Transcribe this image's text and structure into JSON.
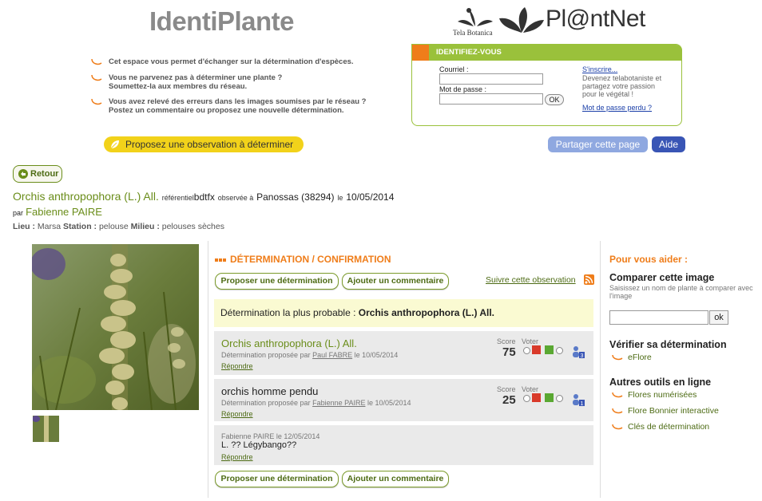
{
  "header": {
    "site_title": "IdentiPlante",
    "partner_tb": "Tela Botanica",
    "partner_pn": "Pl@ntNet"
  },
  "intro": [
    "Cet espace vous permet d'échanger sur la détermination d'espèces.",
    "Vous ne parvenez pas à déterminer une plante ?",
    "Soumettez-la aux membres du réseau.",
    "Vous avez relevé des erreurs dans les images soumises par le réseau ?",
    "Postez un commentaire ou proposez une nouvelle détermination."
  ],
  "login": {
    "title": "IDENTIFIEZ-VOUS",
    "email_label": "Courriel :",
    "password_label": "Mot de passe :",
    "ok_label": "OK",
    "signup_link": "S'inscrire...",
    "signup_info": [
      "Devenez telabotaniste et",
      "partagez votre passion",
      "pour le végétal !"
    ],
    "lost_password": "Mot de passe perdu ?"
  },
  "actions": {
    "propose_observation": "Proposez une observation à déterminer",
    "share": "Partager cette page",
    "help": "Aide",
    "back": "Retour"
  },
  "observation": {
    "species": "Orchis anthropophora (L.) All.",
    "ref_label": "référentiel",
    "ref_value": "bdtfx",
    "observed_label": "observée à",
    "place": "Panossas (38294)",
    "date_label": "le",
    "date": "10/05/2014",
    "by_label": "par",
    "author": "Fabienne PAIRE",
    "lieu_label": "Lieu :",
    "lieu_value": "Marsa",
    "station_label": "Station :",
    "station_value": "pelouse",
    "milieu_label": "Milieu :",
    "milieu_value": "pelouses sèches"
  },
  "determination": {
    "section_title": "DÉTERMINATION / CONFIRMATION",
    "propose_btn": "Proposer une détermination",
    "comment_btn": "Ajouter un commentaire",
    "follow_link": "Suivre cette observation",
    "probable_label": "Détermination la plus probable :",
    "probable_value": "Orchis anthropophora (L.) All.",
    "score_label": "Score",
    "vote_label": "Voter",
    "reply_label": "Répondre",
    "proposals": [
      {
        "name": "Orchis anthropophora (L.) All.",
        "meta_prefix": "Détermination proposée par",
        "author": "Paul FABRE",
        "date_prefix": "le",
        "date": "10/05/2014",
        "score": "75",
        "votes": "3"
      },
      {
        "name": "orchis homme pendu",
        "meta_prefix": "Détermination proposée par",
        "author": "Fabienne PAIRE",
        "date_prefix": "le",
        "date": "10/05/2014",
        "score": "25",
        "votes": "1"
      }
    ],
    "comment": {
      "header": "Fabienne PAIRE le 12/05/2014",
      "text": "L. ?? Légybangо??"
    }
  },
  "help": {
    "title": "Pour vous aider :",
    "compare_title": "Comparer cette image",
    "compare_desc": "Saisissez un nom de plante à comparer avec l'image",
    "ok_label": "ok",
    "verify_title": "Vérifier sa détermination",
    "verify_link": "eFlore",
    "tools_title": "Autres outils en ligne",
    "tools": [
      "Flores numérisées",
      "Flore Bonnier interactive",
      "Clés de détermination"
    ]
  },
  "colors": {
    "accent_green": "#9ac13b",
    "accent_orange": "#ef7d1a",
    "link_green": "#4d6b14",
    "help_blue": "#3955b5"
  }
}
